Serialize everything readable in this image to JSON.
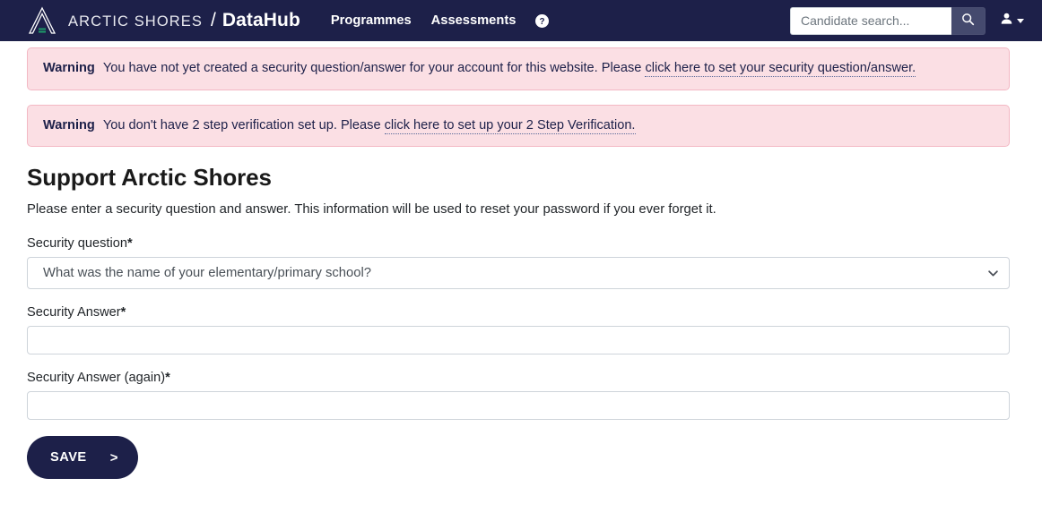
{
  "navbar": {
    "brand": {
      "logo_icon": "arctic-shores-triangle-logo",
      "arctic_shores": "ARCTIC SHORES",
      "separator": "/",
      "product": "DataHub"
    },
    "links": [
      {
        "label": "Programmes"
      },
      {
        "label": "Assessments"
      }
    ],
    "help_icon": "question-circle-icon",
    "search": {
      "placeholder": "Candidate search...",
      "value": "",
      "button_icon": "search-icon"
    },
    "user": {
      "icon": "user-avatar-icon",
      "caret": "chevron-down-icon"
    },
    "colors": {
      "background": "#1d2049",
      "search_button": "#454a6e",
      "logo_accent": "#1e9e6a"
    }
  },
  "alerts": [
    {
      "label": "Warning",
      "text": "You have not yet created a security question/answer for your account for this website. Please",
      "link": "click here to set your security question/answer."
    },
    {
      "label": "Warning",
      "text": "You don't have 2 step verification set up. Please",
      "link": "click here to set up your 2 Step Verification."
    }
  ],
  "main": {
    "title": "Support Arctic Shores",
    "description": "Please enter a security question and answer. This information will be used to reset your password if you ever forget it.",
    "fields": {
      "security_question": {
        "label": "Security question",
        "required_marker": "*",
        "selected": "What was the name of your elementary/primary school?",
        "chevron_icon": "chevron-down-icon"
      },
      "security_answer": {
        "label": "Security Answer",
        "required_marker": "*",
        "value": "",
        "placeholder": ""
      },
      "security_answer_again": {
        "label": "Security Answer (again)",
        "required_marker": "*",
        "value": "",
        "placeholder": ""
      }
    },
    "save_button": {
      "label": "SAVE",
      "chevron": ">"
    }
  },
  "colors": {
    "alert_bg": "#fbdfe4",
    "alert_border": "#f3b8c4",
    "alert_text": "#1d2049",
    "primary": "#1d2049"
  }
}
